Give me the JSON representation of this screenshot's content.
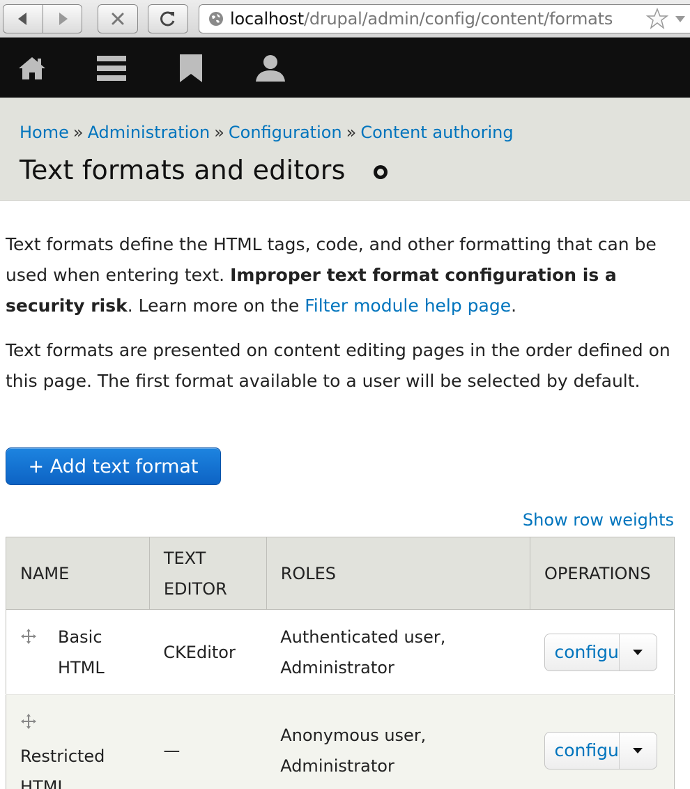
{
  "browser": {
    "url_host": "localhost",
    "url_path": "/drupal/admin/config/content/formats",
    "icons": [
      "back-icon",
      "forward-icon",
      "stop-icon",
      "reload-icon",
      "globe-icon",
      "bookmark-star-icon",
      "dropdown-arrow-icon"
    ]
  },
  "toolbar": {
    "icons": [
      "home-icon",
      "menu-icon",
      "bookmark-icon",
      "user-icon"
    ]
  },
  "header": {
    "breadcrumb": {
      "home": "Home",
      "administration": "Administration",
      "configuration": "Configuration",
      "content_authoring": "Content authoring",
      "separator": "»"
    },
    "title": "Text formats and editors",
    "shortcut_icon": "add-shortcut-icon"
  },
  "intro": {
    "p1_start": "Text formats define the HTML tags, code, and other formatting that can be used when entering text. ",
    "p1_strong": "Improper text format configuration is a security risk",
    "p1_mid": ". Learn more on the ",
    "p1_link": "Filter module help page",
    "p1_end": ".",
    "p2": "Text formats are presented on content editing pages in the order defined on this page. The first format available to a user will be selected by default."
  },
  "actions": {
    "add_button": "+ Add text format",
    "show_weights": "Show row weights"
  },
  "table": {
    "headers": {
      "name": "NAME",
      "text_editor_line1": "TEXT",
      "text_editor_line2": "EDITOR",
      "roles": "ROLES",
      "operations": "OPERATIONS"
    },
    "rows": [
      {
        "name_line1": "Basic",
        "name_line2": "HTML",
        "editor": "CKEditor",
        "roles_line1": "Authenticated user,",
        "roles_line2": "Administrator",
        "operation": "configure"
      },
      {
        "name_line1": "Restricted",
        "name_line2": "HTML",
        "editor": "—",
        "roles_line1": "Anonymous user,",
        "roles_line2": "Administrator",
        "operation": "configure"
      }
    ]
  },
  "colors": {
    "link": "#0074bd",
    "toolbar_bg": "#0f0f0f",
    "header_bg": "#e1e2dc",
    "primary_button": "#1a7ad6"
  }
}
